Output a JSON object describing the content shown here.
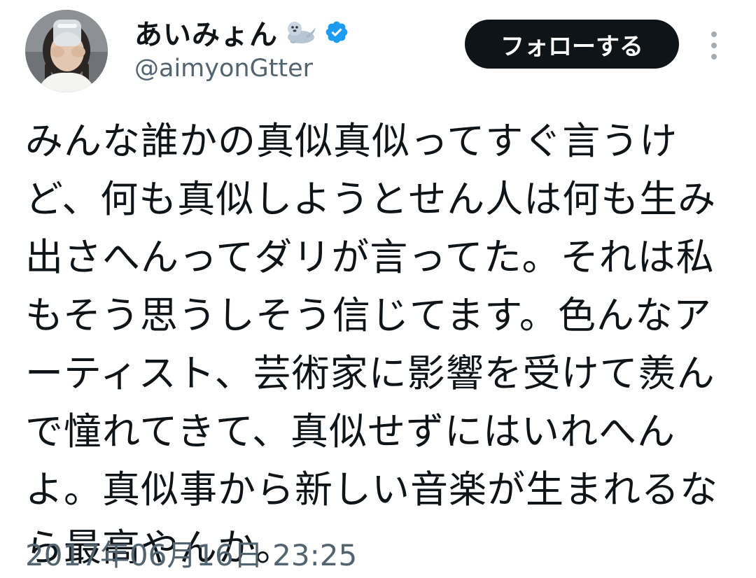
{
  "author": {
    "display_name": "あいみょん",
    "name_emoji_icon": "seal-emoji-icon",
    "verified_icon": "verified-badge-icon",
    "handle": "@aimyonGtter"
  },
  "follow_button": {
    "label": "フォローする"
  },
  "more_menu": {
    "icon": "vertical-dots-icon"
  },
  "tweet": {
    "lines": [
      "みんな誰かの真似真似ってすぐ言うけ",
      "ど、何も真似しようとせん人は何も生み",
      "出さへんってダリが言ってた。それは私",
      "もそう思うしそう信じてます。色んなア",
      "ーティスト、芸術家に影響を受けて羨ん",
      "で憧れてきて、真似せずにはいれへん",
      "よ。真似事から新しい音楽が生まれるな",
      "ら最高やんか。"
    ],
    "timestamp": "2017年06月16日 23:25"
  },
  "colors": {
    "text_primary": "#0f1419",
    "text_secondary": "#536471",
    "verified_blue": "#1d9bf0",
    "button_bg": "#0f1419",
    "button_text": "#ffffff",
    "background": "#ffffff"
  }
}
